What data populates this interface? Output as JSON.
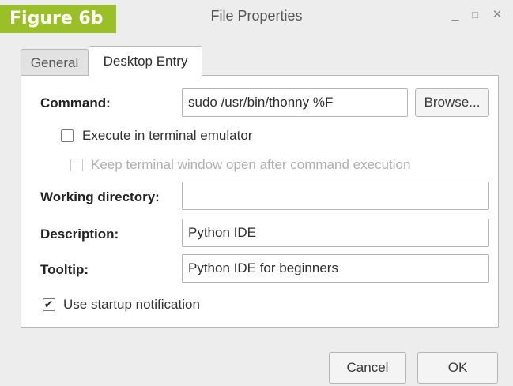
{
  "overlay": {
    "figure_label": "Figure 6b"
  },
  "window": {
    "title": "File Properties",
    "controls": {
      "minimize": "_",
      "maximize": "□",
      "close": "✕"
    }
  },
  "tabs": [
    {
      "label": "General",
      "active": false
    },
    {
      "label": "Desktop Entry",
      "active": true
    }
  ],
  "desktop_entry": {
    "command": {
      "label": "Command:",
      "value": "sudo /usr/bin/thonny %F",
      "browse_label": "Browse..."
    },
    "execute_in_terminal": {
      "label": "Execute in terminal emulator",
      "checked": false
    },
    "keep_terminal_open": {
      "label": "Keep terminal window open after command execution",
      "checked": false,
      "disabled": true
    },
    "working_directory": {
      "label": "Working directory:",
      "value": ""
    },
    "description": {
      "label": "Description:",
      "value": "Python IDE"
    },
    "tooltip": {
      "label": "Tooltip:",
      "value": "Python IDE for beginners"
    },
    "startup_notification": {
      "label": "Use startup notification",
      "checked": true,
      "check_glyph": "✔"
    }
  },
  "buttons": {
    "cancel": "Cancel",
    "ok": "OK"
  }
}
